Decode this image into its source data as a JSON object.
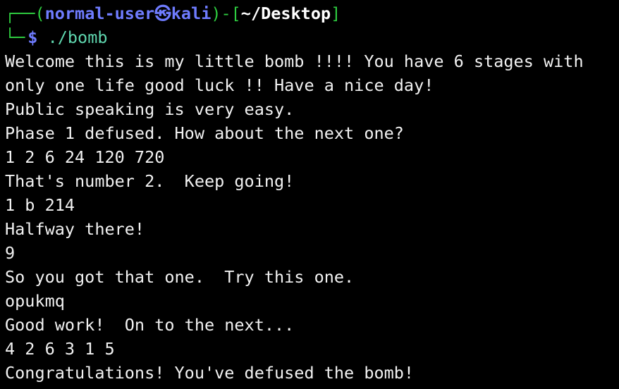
{
  "prompt": {
    "corner_top": "┌──",
    "open_paren": "(",
    "user": "normal-user",
    "at_symbol": "㉿",
    "host": "kali",
    "close_paren": ")",
    "separator": "-[",
    "path": "~/Desktop",
    "close_bracket": "]",
    "corner_bottom": "└─",
    "dollar": "$",
    "command": "./bomb"
  },
  "output_lines": [
    "Welcome this is my little bomb !!!! You have 6 stages with",
    "only one life good luck !! Have a nice day!",
    "Public speaking is very easy.",
    "Phase 1 defused. How about the next one?",
    "1 2 6 24 120 720",
    "That's number 2.  Keep going!",
    "1 b 214",
    "Halfway there!",
    "9",
    "So you got that one.  Try this one.",
    "opukmq",
    "Good work!  On to the next...",
    "4 2 6 3 1 5",
    "Congratulations! You've defused the bomb!"
  ],
  "colors": {
    "background": "#000000",
    "text": "#f2f2f2",
    "prompt_green": "#2ecc40",
    "prompt_blue": "#6f7cff",
    "command": "#5fd7af"
  }
}
